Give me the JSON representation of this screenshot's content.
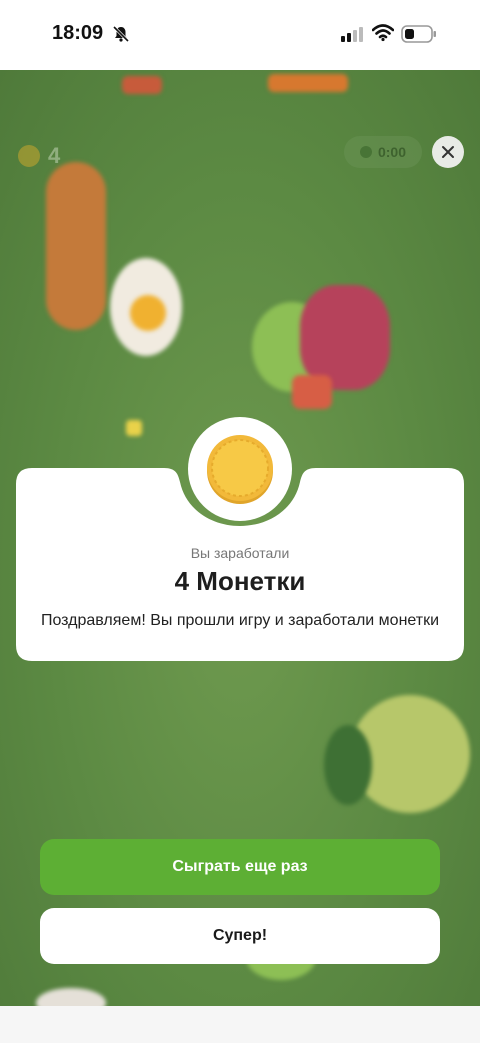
{
  "status_bar": {
    "time": "18:09",
    "icons": [
      "bell-off-icon",
      "signal-icon",
      "wifi-icon",
      "battery-icon"
    ]
  },
  "game_hud": {
    "coin_count": "4",
    "timer": "0:00"
  },
  "result_card": {
    "earned_label": "Вы заработали",
    "coins_title": "4 Монетки",
    "congrats_text": "Поздравляем! Вы прошли игру и заработали монетки"
  },
  "actions": {
    "play_again": "Сыграть еще раз",
    "ok": "Супер!"
  },
  "colors": {
    "accent_green": "#5daf34",
    "background_green": "#5c8a43",
    "coin_gold": "#f5c63a"
  }
}
